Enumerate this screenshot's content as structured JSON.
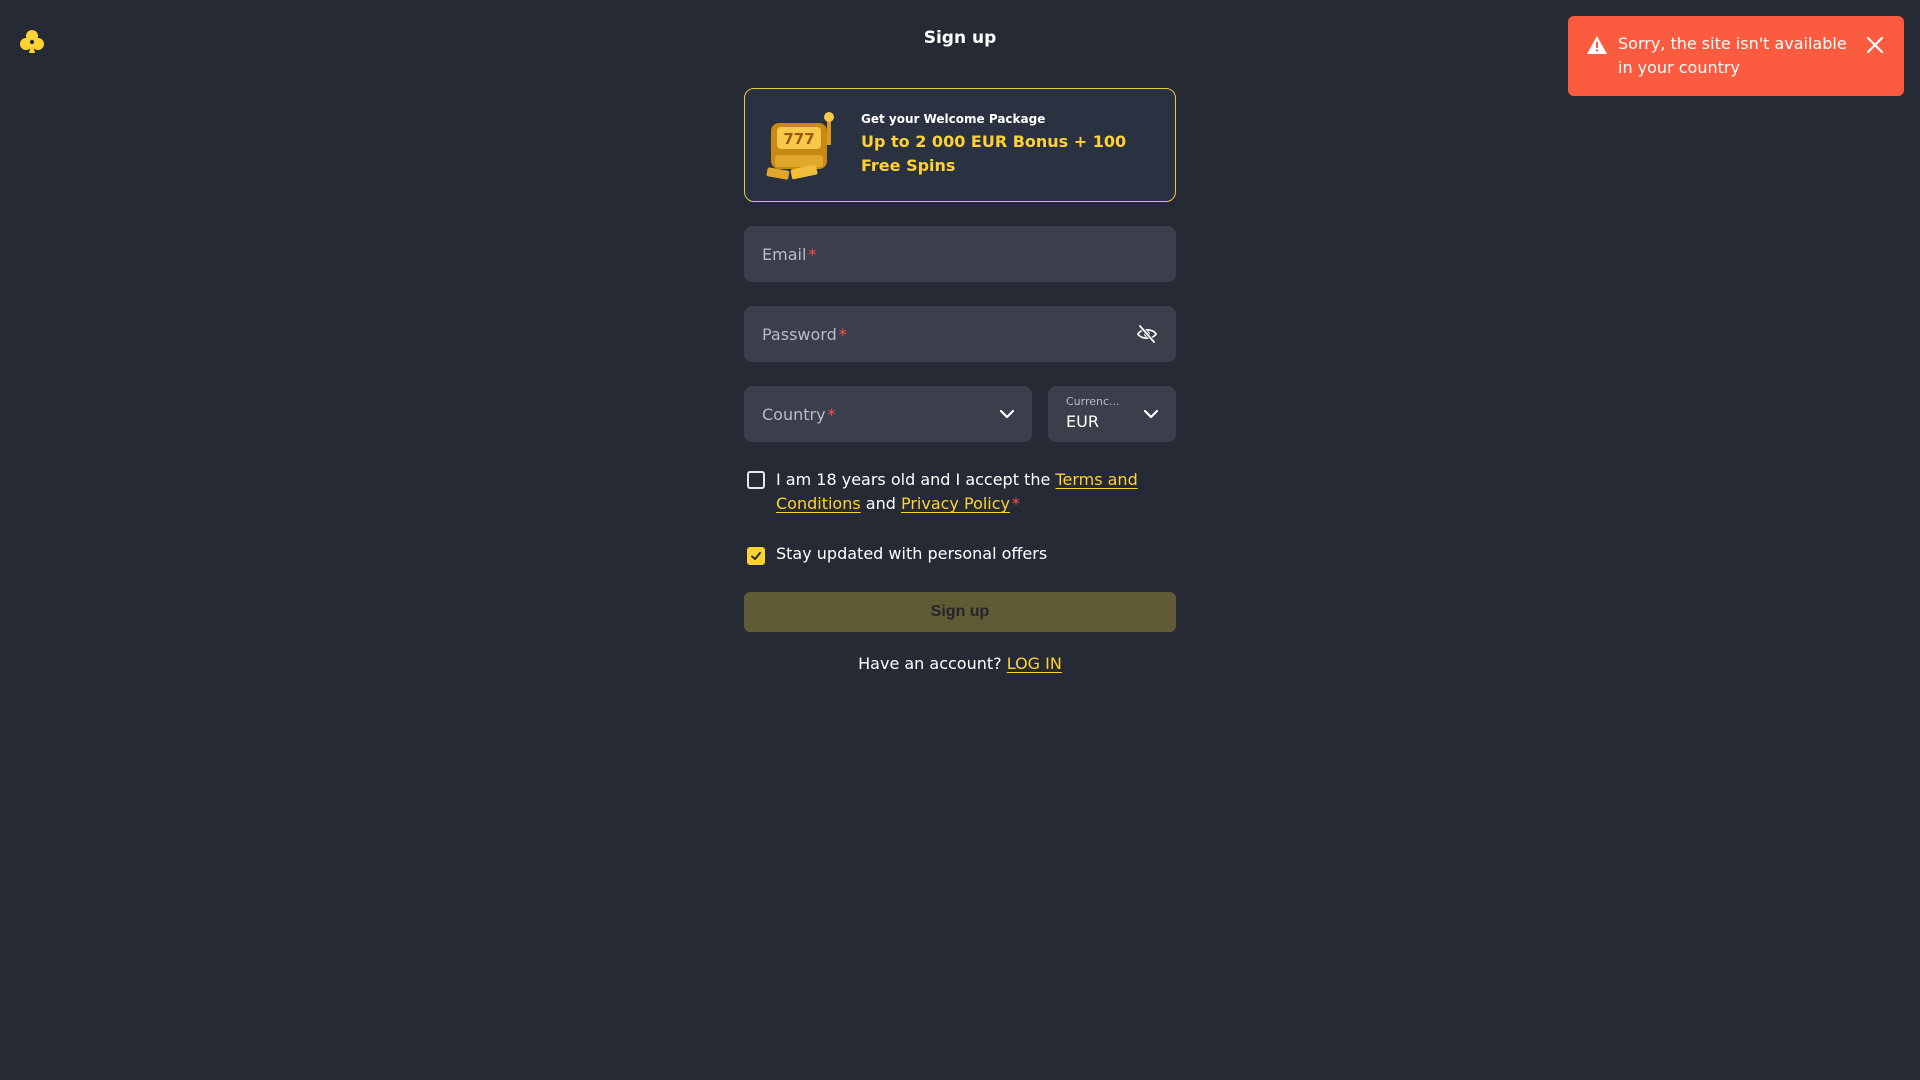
{
  "header": {
    "title": "Sign up",
    "logo_icon": "clover-logo-icon"
  },
  "toast": {
    "message": "Sorry, the site isn't available in your country",
    "color": "#fb5b3e",
    "icon": "warning-icon",
    "close_icon": "close-icon"
  },
  "promo": {
    "subtitle": "Get your Welcome Package",
    "headline": "Up to 2 000 EUR Bonus + 100 Free Spins",
    "image": "slot-machine-image"
  },
  "form": {
    "email_label": "Email",
    "password_label": "Password",
    "country_label": "Country",
    "currency_label": "Currenc...",
    "currency_value": "EUR",
    "required_mark": "*",
    "terms": {
      "prefix": "I am 18 years old and I accept the ",
      "terms_link": "Terms and Conditions",
      "middle": " and ",
      "privacy_link": "Privacy Policy",
      "checked": false
    },
    "offers": {
      "label": "Stay updated with personal offers",
      "checked": true
    },
    "submit_label": "Sign up",
    "account_prompt": "Have an account? ",
    "login_link": "LOG IN"
  },
  "colors": {
    "background": "#252a34",
    "accent": "#ffd234",
    "field": "#3a3f4b",
    "required": "#ff4d4d"
  }
}
